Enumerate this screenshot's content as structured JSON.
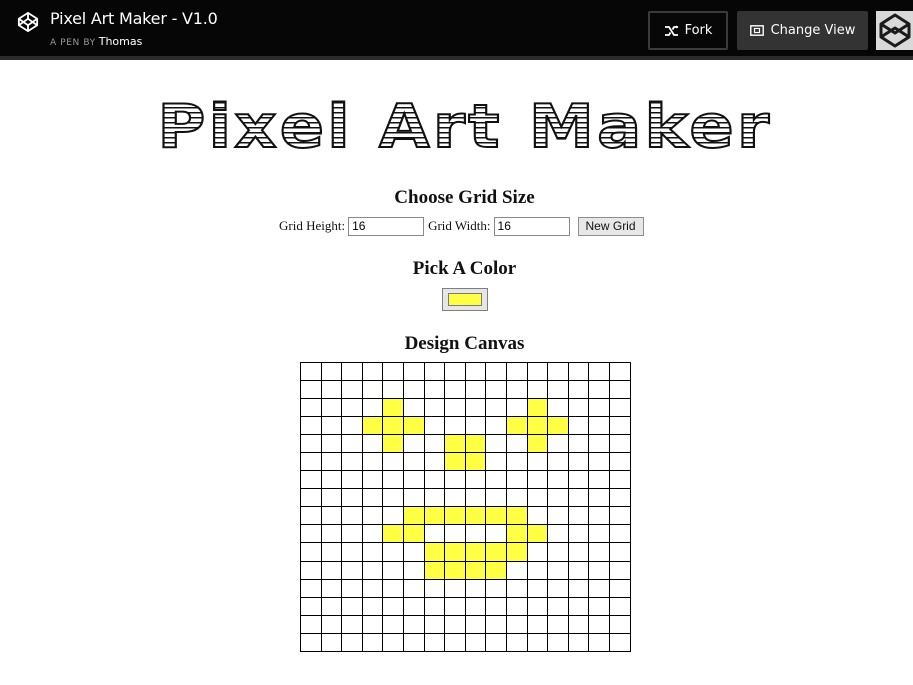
{
  "header": {
    "pen_title": "Pixel Art Maker - V1.0",
    "pen_by_prefix": "A PEN BY",
    "author": "Thomas",
    "fork_label": "Fork",
    "change_view_label": "Change View",
    "icons": [
      "codepen-logo-icon",
      "fork-icon",
      "change-view-icon",
      "avatar-icon"
    ]
  },
  "page": {
    "logo_text": "Pixel Art Maker",
    "grid_size_heading": "Choose Grid Size",
    "grid_height_label": "Grid Height:",
    "grid_height_value": "16",
    "grid_width_label": "Grid Width:",
    "grid_width_value": "16",
    "new_grid_label": "New Grid",
    "pick_color_heading": "Pick A Color",
    "selected_color": "#ffff44",
    "design_canvas_heading": "Design Canvas"
  },
  "canvas": {
    "rows": 16,
    "cols": 16,
    "fill_color": "#ffff44",
    "filled_cells": [
      [
        2,
        4
      ],
      [
        2,
        11
      ],
      [
        3,
        3
      ],
      [
        3,
        4
      ],
      [
        3,
        5
      ],
      [
        3,
        10
      ],
      [
        3,
        11
      ],
      [
        3,
        12
      ],
      [
        4,
        4
      ],
      [
        4,
        7
      ],
      [
        4,
        8
      ],
      [
        4,
        11
      ],
      [
        5,
        7
      ],
      [
        5,
        8
      ],
      [
        8,
        5
      ],
      [
        8,
        6
      ],
      [
        8,
        7
      ],
      [
        8,
        8
      ],
      [
        8,
        9
      ],
      [
        8,
        10
      ],
      [
        9,
        4
      ],
      [
        9,
        5
      ],
      [
        9,
        10
      ],
      [
        9,
        11
      ],
      [
        10,
        6
      ],
      [
        10,
        7
      ],
      [
        10,
        8
      ],
      [
        10,
        9
      ],
      [
        10,
        10
      ],
      [
        11,
        6
      ],
      [
        11,
        7
      ],
      [
        11,
        8
      ],
      [
        11,
        9
      ]
    ]
  }
}
